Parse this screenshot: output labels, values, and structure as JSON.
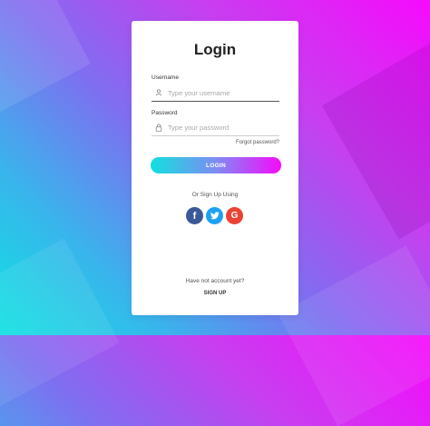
{
  "colors": {
    "background_gradient": [
      "#f60afc",
      "#c83ef0",
      "#7f6ef0",
      "#39b4ec",
      "#0fe2e1"
    ],
    "button_gradient": [
      "#12e0de",
      "#7e8cf2",
      "#f60afc"
    ],
    "facebook": "#3b5998",
    "twitter": "#1da1f2",
    "google": "#ea4335"
  },
  "card": {
    "title": "Login",
    "username": {
      "label": "Username",
      "placeholder": "Type your username",
      "icon": "user-icon"
    },
    "password": {
      "label": "Password",
      "placeholder": "Type your password",
      "icon": "lock-icon"
    },
    "forgot_password": "Forgot password?",
    "login_button": "LOGIN",
    "alt_signup_text": "Or Sign Up Using",
    "social": [
      {
        "name": "facebook",
        "glyph": "f",
        "icon": "facebook-icon"
      },
      {
        "name": "twitter",
        "glyph": "",
        "icon": "twitter-icon"
      },
      {
        "name": "google",
        "glyph": "G",
        "icon": "google-icon"
      }
    ],
    "no_account_text": "Have not account yet?",
    "signup_link": "SIGN UP"
  }
}
